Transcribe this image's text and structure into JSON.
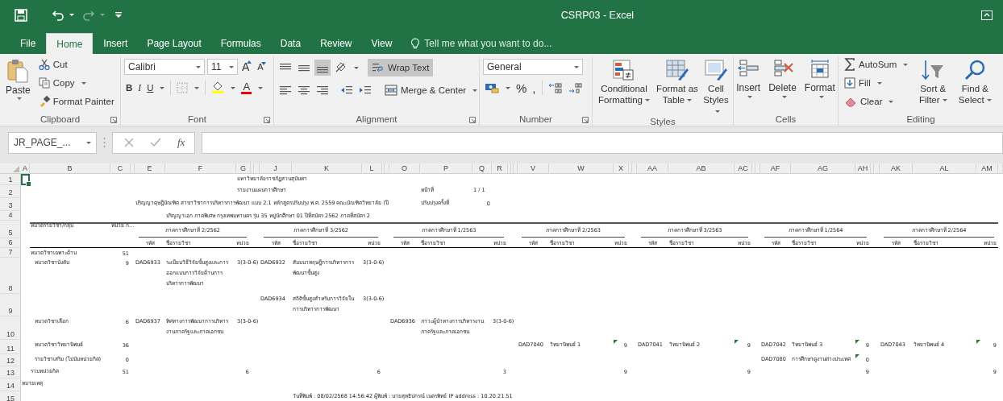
{
  "window": {
    "title": "CSRP03 - Excel"
  },
  "tabs": [
    {
      "label": "File",
      "selected": false
    },
    {
      "label": "Home",
      "selected": true
    },
    {
      "label": "Insert",
      "selected": false
    },
    {
      "label": "Page Layout",
      "selected": false
    },
    {
      "label": "Formulas",
      "selected": false
    },
    {
      "label": "Data",
      "selected": false
    },
    {
      "label": "Review",
      "selected": false
    },
    {
      "label": "View",
      "selected": false
    }
  ],
  "tell_me": {
    "placeholder": "Tell me what you want to do..."
  },
  "ribbon": {
    "clipboard": {
      "label": "Clipboard",
      "paste": "Paste",
      "cut": "Cut",
      "copy": "Copy",
      "format_painter": "Format Painter"
    },
    "font": {
      "label": "Font",
      "font_name": "Calibri",
      "font_size": "11",
      "grow_font": "A",
      "shrink_font": "A",
      "bold": "B",
      "italic": "I",
      "underline": "U",
      "font_color": "A"
    },
    "alignment": {
      "label": "Alignment",
      "bottom_align_on": true,
      "wrap_text": {
        "label": "Wrap Text",
        "on": true
      },
      "merge_center": "Merge & Center"
    },
    "number": {
      "label": "Number",
      "format": "General",
      "percent": "%",
      "comma": ","
    },
    "styles": {
      "label": "Styles",
      "buttons": [
        "Conditional Formatting",
        "Format as Table",
        "Cell Styles"
      ]
    },
    "cells": {
      "label": "Cells",
      "buttons": [
        "Insert",
        "Delete",
        "Format"
      ]
    },
    "editing": {
      "label": "Editing",
      "autosum": "AutoSum",
      "fill": "Fill",
      "clear": "Clear",
      "sort_filter": "Sort & Filter",
      "find_select": "Find & Select"
    }
  },
  "formula_bar": {
    "name_box": "JR_PAGE_...",
    "fx": "fx"
  },
  "sheet": {
    "columns": [
      "A",
      "B",
      "C",
      "E",
      "F",
      "G",
      "J",
      "K",
      "L",
      "O",
      "P",
      "Q",
      "R",
      "V",
      "W",
      "X",
      "AA",
      "AB",
      "AC",
      "AF",
      "AG",
      "AH",
      "AK",
      "AL",
      "AM"
    ],
    "semesters": [
      {
        "title": "ภาคการศึกษาที่ 2/2562",
        "columns": [
          "รหัส",
          "ชื่อรายวิชา",
          "หน่วย"
        ]
      },
      {
        "title": "ภาคการศึกษาที่ 3/2562",
        "columns": [
          "รหัส",
          "ชื่อรายวิชา",
          "หน่วย"
        ]
      },
      {
        "title": "ภาคการศึกษาที่ 1/2563",
        "columns": [
          "รหัส",
          "ชื่อรายวิชา",
          "หน่วย"
        ]
      },
      {
        "title": "ภาคการศึกษาที่ 2/2563",
        "columns": [
          "รหัส",
          "ชื่อรายวิชา",
          "หน่วย"
        ]
      },
      {
        "title": "ภาคการศึกษาที่ 3/2563",
        "columns": [
          "รหัส",
          "ชื่อรายวิชา",
          "หน่วย"
        ]
      },
      {
        "title": "ภาคการศึกษาที่ 1/2564",
        "columns": [
          "รหัส",
          "ชื่อรายวิชา",
          "หน่วย"
        ]
      },
      {
        "title": "ภาคการศึกษาที่ 2/2564",
        "columns": [
          "รหัส",
          "ชื่อรายวิชา",
          "หน่วย"
        ]
      }
    ],
    "rows": [
      {
        "number": "1",
        "cells": [
          {
            "selected": true
          },
          "",
          "",
          "",
          "",
          "มหาวิทยาลัยราชภัฏสวนสุนันทา"
        ]
      },
      {
        "number": "2",
        "cells": [
          "",
          "",
          "",
          "",
          "",
          "รายงานแผนการศึกษา",
          "",
          "",
          "",
          "",
          "หน้าที่",
          "1 / 1"
        ]
      },
      {
        "number": "3",
        "cells": [
          "",
          "",
          "",
          "ปริญญาดุษฎีบัณฑิต สาขาวิชาการบริหารการพัฒนา แบบ 2.1 หลักสูตรปรับปรุง พ.ศ. 2559 คณะบัณฑิตวิทยาลัย (ปี",
          "",
          "",
          "",
          "",
          "",
          "",
          "ปรับปรุงครั้งที่",
          "0"
        ]
      },
      {
        "number": "4",
        "cells": [
          "",
          "",
          "",
          "",
          "ปริญญาเอก ภาคพิเศษ กรุงเทพมหานคร รุ่น 35 หมู่นักศึกษา 01 ปีที่สมัคร 2562 ภาคที่สมัคร 2"
        ]
      },
      {
        "number": "5",
        "cells": [
          "",
          "หมวดรายวิชา/กลุ่ม",
          "หน่วย ก..."
        ]
      },
      {
        "number": "6",
        "cells": []
      },
      {
        "number": "7",
        "cells": [
          "",
          "หมวดวิชาเฉพาะด้าน",
          "51"
        ]
      },
      {
        "number": "8",
        "cells": [
          "",
          {
            "text": "หมวดวิชาบังคับ",
            "indented": true
          },
          "9",
          "DAD6933",
          "ระเบียบวิธีวิจัยขั้นสูงและการออกแบบการวิจัยด้านการบริหารการพัฒนา",
          "3(3-0-6)",
          "DAD6932",
          "สัมมนาทฤษฎีการบริหารการพัฒนาขั้นสูง",
          "3(3-0-6)"
        ]
      },
      {
        "number": "9",
        "cells": [
          "",
          "",
          "",
          "",
          "",
          "",
          "DAD6934",
          "สถิติขั้นสูงสำหรับการวิจัยในการบริหารการพัฒนา",
          "3(3-0-6)"
        ]
      },
      {
        "number": "10",
        "cells": [
          "",
          {
            "text": "หมวดวิชาเลือก",
            "indented": true
          },
          "6",
          "DAD6937",
          "ทิศทางการพัฒนาการบริหารงานภาครัฐและภาคเอกชน",
          "3(3-0-6)",
          "",
          "",
          "",
          "DAD6936",
          "ภาวะผู้นำทางการบริหารงานภาครัฐและภาคเอกชน",
          "",
          "3(3-0-6)"
        ]
      },
      {
        "number": "11",
        "cells": [
          "",
          {
            "text": "หมวดวิชาวิทยานิพนธ์",
            "indented": true
          },
          "36",
          "",
          "",
          "",
          "",
          "",
          "",
          "",
          "",
          "",
          "",
          "DAD7040",
          "วิทยานิพนธ์ 1",
          {
            "text": "9",
            "error_flag": true
          },
          "DAD7041",
          "วิทยานิพนธ์ 2",
          {
            "text": "9",
            "error_flag": true
          },
          "DAD7042",
          "วิทยานิพนธ์ 3",
          {
            "text": "9",
            "error_flag": true
          },
          "DAD7043",
          "วิทยานิพนธ์ 4",
          {
            "text": "9",
            "error_flag": true
          }
        ]
      },
      {
        "number": "12",
        "cells": [
          "",
          {
            "text": "รายวิชาเสริม (ไม่นับหน่วยกิต)",
            "indented": true
          },
          "0",
          "",
          "",
          "",
          "",
          "",
          "",
          "",
          "",
          "",
          "",
          "",
          "",
          "",
          "",
          "",
          "",
          "DAD7080",
          "การศึกษาดูงานต่างประเทศ",
          {
            "text": "0",
            "error_flag": true
          }
        ]
      },
      {
        "number": "13",
        "cells": [
          "",
          "รวมหน่วยกิต",
          "51",
          "",
          "",
          "6",
          "",
          "",
          "6",
          "",
          "",
          "",
          "3",
          "",
          "",
          "9",
          "",
          "",
          "9",
          "",
          "",
          "9",
          "",
          "",
          "9"
        ]
      },
      {
        "number": "14",
        "cells": [
          "หมายเหตุ"
        ]
      },
      {
        "number": "15",
        "cells": [
          "",
          "",
          "",
          "",
          "",
          "",
          "",
          "วันที่พิมพ์ : 08/02/2568 14:56:42 ผู้พิมพ์ : นายสุทธิปกรณ์ เนตรพิทย์ IP address : 10.20.21.51"
        ]
      }
    ]
  }
}
